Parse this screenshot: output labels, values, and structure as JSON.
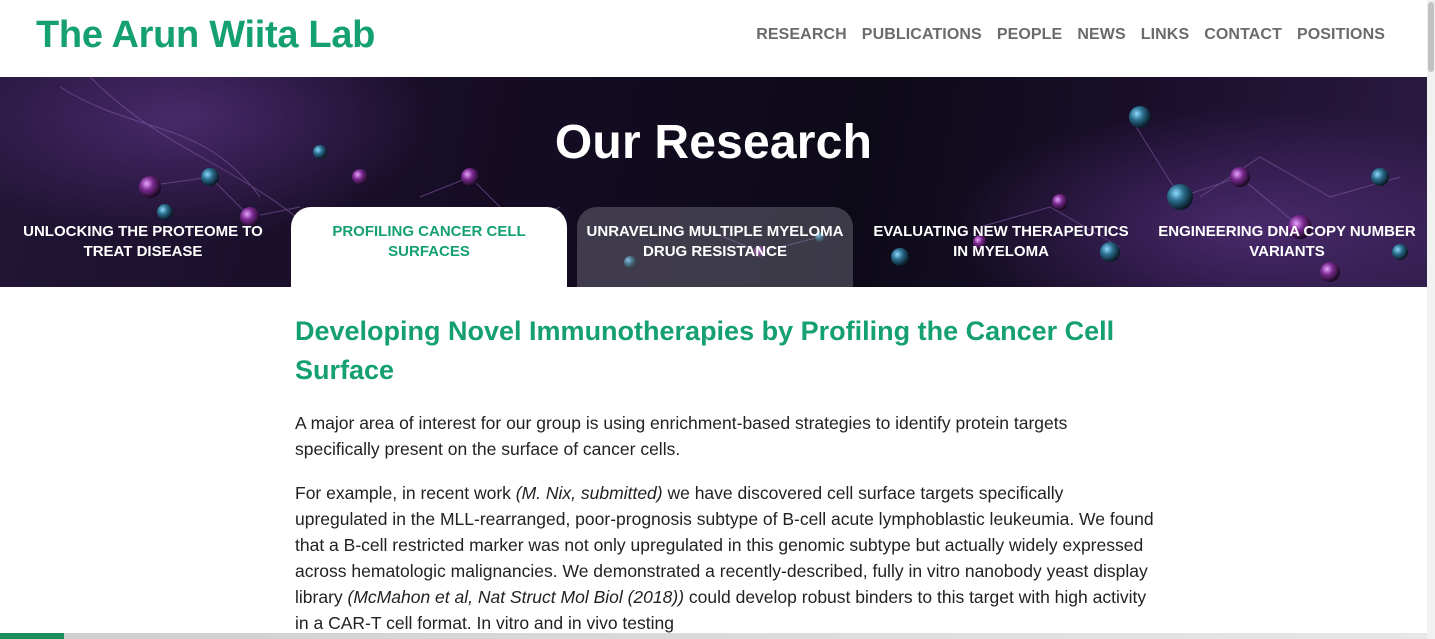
{
  "site": {
    "logo": "The Arun Wiita Lab"
  },
  "nav": {
    "items": [
      {
        "label": "RESEARCH"
      },
      {
        "label": "PUBLICATIONS"
      },
      {
        "label": "PEOPLE"
      },
      {
        "label": "NEWS"
      },
      {
        "label": "LINKS"
      },
      {
        "label": "CONTACT"
      },
      {
        "label": "POSITIONS"
      }
    ]
  },
  "hero": {
    "title": "Our Research",
    "tabs": [
      {
        "line1": "UNLOCKING THE PROTEOME TO",
        "line2": "TREAT DISEASE"
      },
      {
        "line1": "PROFILING CANCER CELL",
        "line2": "SURFACES"
      },
      {
        "line1": "UNRAVELING MULTIPLE MYELOMA",
        "line2": "DRUG RESISTANCE"
      },
      {
        "line1": "EVALUATING NEW THERAPEUTICS",
        "line2": "IN MYELOMA"
      },
      {
        "line1": "ENGINEERING DNA COPY NUMBER",
        "line2": "VARIANTS"
      }
    ]
  },
  "article": {
    "title": "Developing Novel Immunotherapies by Profiling the Cancer Cell Surface",
    "p1": "A major area of interest for our group is using enrichment-based strategies to identify protein targets specifically present on the surface of cancer cells.",
    "p2": {
      "a": "For example, in recent work ",
      "b": "(M. Nix, submitted)",
      "c": " we have discovered cell surface targets specifically upregulated in the MLL-rearranged, poor-prognosis subtype of B-cell acute lymphoblastic leukeumia. We found that a B-cell restricted marker was not only upregulated in this genomic subtype but actually widely expressed across hematologic malignancies. We demonstrated a recently-described, fully in vitro nanobody yeast display library ",
      "d": "(McMahon et al, Nat Struct Mol Biol (2018))",
      "e": " could develop robust binders to this target with high activity in a CAR-T cell format. In vitro and in vivo testing"
    }
  },
  "colors": {
    "brand_green": "#14a06f",
    "nav_gray": "#6b6b6b"
  }
}
